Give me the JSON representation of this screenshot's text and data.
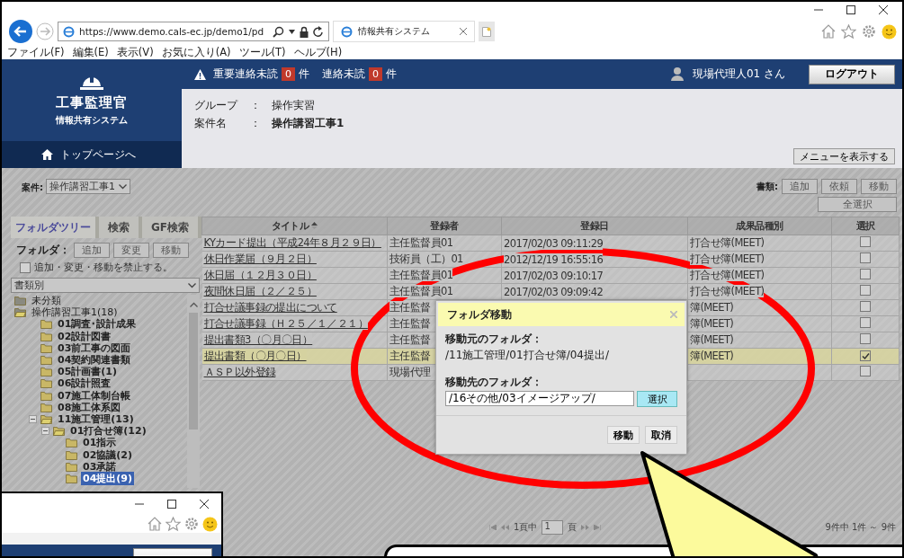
{
  "browser": {
    "address": "https://www.demo.cals-ec.jp/demo1/pd",
    "tab_title": "情報共有システム",
    "menu": [
      "ファイル(F)",
      "編集(E)",
      "表示(V)",
      "お気に入り(A)",
      "ツール(T)",
      "ヘルプ(H)"
    ]
  },
  "brand": {
    "title": "工事監理官",
    "subtitle": "情報共有システム",
    "home_link": "トップページへ"
  },
  "alerts": [
    {
      "label": "重要連絡未読",
      "count": "0",
      "unit": "件"
    },
    {
      "label": "連絡未読",
      "count": "0",
      "unit": "件"
    }
  ],
  "user": "現場代理人01 さん",
  "logout": "ログアウト",
  "info": [
    {
      "label": "グループ",
      "sep": "：",
      "value": "操作実習",
      "bold": false
    },
    {
      "label": "案件名",
      "sep": "：",
      "value": "操作講習工事1",
      "bold": true
    }
  ],
  "menu_button": "メニューを表示する",
  "project_select": {
    "label": "案件:",
    "value": "操作講習工事1"
  },
  "doc_actions": {
    "label": "書類:",
    "buttons": [
      "追加",
      "依頼",
      "移動"
    ],
    "select_all": "全選択"
  },
  "side_tabs": [
    {
      "label": "フォルダツリー",
      "selected": true
    },
    {
      "label": "検索",
      "selected": false
    },
    {
      "label": "GF検索",
      "selected": false
    }
  ],
  "folder_actions": {
    "label": "フォルダ：",
    "buttons": [
      "追加",
      "変更",
      "移動"
    ]
  },
  "lock": {
    "label": "追加・変更・移動を禁止する。",
    "checked": false
  },
  "tree_filter": "書類別",
  "tree": [
    {
      "label": "未分類",
      "expanded": false,
      "selected": false
    },
    {
      "label": "操作講習工事1(18)",
      "expanded": true,
      "selected": false,
      "children": [
        {
          "label": "01調査･設計成果",
          "expanded": false,
          "selected": false
        },
        {
          "label": "02設計図書",
          "expanded": false,
          "selected": false
        },
        {
          "label": "03前工事の図面",
          "expanded": false,
          "selected": false
        },
        {
          "label": "04契約関連書類",
          "expanded": false,
          "selected": false
        },
        {
          "label": "05計画書(1)",
          "expanded": false,
          "selected": false
        },
        {
          "label": "06設計照査",
          "expanded": false,
          "selected": false
        },
        {
          "label": "07施工体制台帳",
          "expanded": false,
          "selected": false
        },
        {
          "label": "08施工体系図",
          "expanded": false,
          "selected": false
        },
        {
          "label": "11施工管理(13)",
          "expanded": true,
          "selected": false,
          "children": [
            {
              "label": "01打合せ簿(12)",
              "expanded": true,
              "selected": false,
              "children": [
                {
                  "label": "01指示",
                  "expanded": false,
                  "selected": false
                },
                {
                  "label": "02協議(2)",
                  "expanded": false,
                  "selected": false
                },
                {
                  "label": "03承諾",
                  "expanded": false,
                  "selected": false
                },
                {
                  "label": "04提出(9)",
                  "expanded": false,
                  "selected": true
                }
              ]
            }
          ]
        }
      ]
    }
  ],
  "table": {
    "columns": [
      {
        "label": "タイトル",
        "sorted": true
      },
      {
        "label": "登録者",
        "sorted": false
      },
      {
        "label": "登録日",
        "sorted": false
      },
      {
        "label": "成果品種別",
        "sorted": false
      },
      {
        "label": "選択",
        "sorted": false
      }
    ],
    "rows": [
      {
        "title": "KYカード提出（平成24年８月２９日）",
        "registrant": "主任監督員01",
        "date": "2017/02/03 09:11:29",
        "type": "打合せ簿(MEET)",
        "checked": false
      },
      {
        "title": "休日作業届（９月２日）",
        "registrant": "技術員（工）01",
        "date": "2012/12/19 16:55:16",
        "type": "打合せ簿(MEET)",
        "checked": false
      },
      {
        "title": "休日届（１２月３０日）",
        "registrant": "主任監督員01",
        "date": "2017/02/03 09:10:17",
        "type": "打合せ簿(MEET)",
        "checked": false
      },
      {
        "title": "夜間休日届（２／２５）",
        "registrant": "主任監督員01",
        "date": "2017/02/03 09:09:42",
        "type": "打合せ簿(MEET)",
        "checked": false
      },
      {
        "title": "打合せ議事録の提出について",
        "registrant": "主任監督",
        "type": "簿(MEET)",
        "checked": false
      },
      {
        "title": "打合せ議事録（Ｈ２５／１／２１）",
        "registrant": "主任監督",
        "type": "簿(MEET)",
        "checked": false
      },
      {
        "title": "提出書類3（〇月〇日）",
        "registrant": "主任監督",
        "type": "簿(MEET)",
        "checked": false
      },
      {
        "title": "提出書類（〇月〇日）",
        "registrant": "主任監督",
        "type": "簿(MEET)",
        "checked": true
      },
      {
        "title": "ＡＳＰ以外登録",
        "registrant": "現場代理",
        "checked": false
      }
    ]
  },
  "pager": {
    "of_label": "1頁中",
    "page": "1",
    "unit": "頁",
    "summary": "9件中 1件 ～ 9件"
  },
  "dialog": {
    "title": "フォルダ移動",
    "source_label": "移動元のフォルダ：",
    "source_path": "/11施工管理/01打合せ簿/04提出/",
    "target_label": "移動先のフォルダ：",
    "target_path": "/16その他/03イメージアップ/",
    "pick": "選択",
    "ok": "移動",
    "cancel": "取消"
  }
}
